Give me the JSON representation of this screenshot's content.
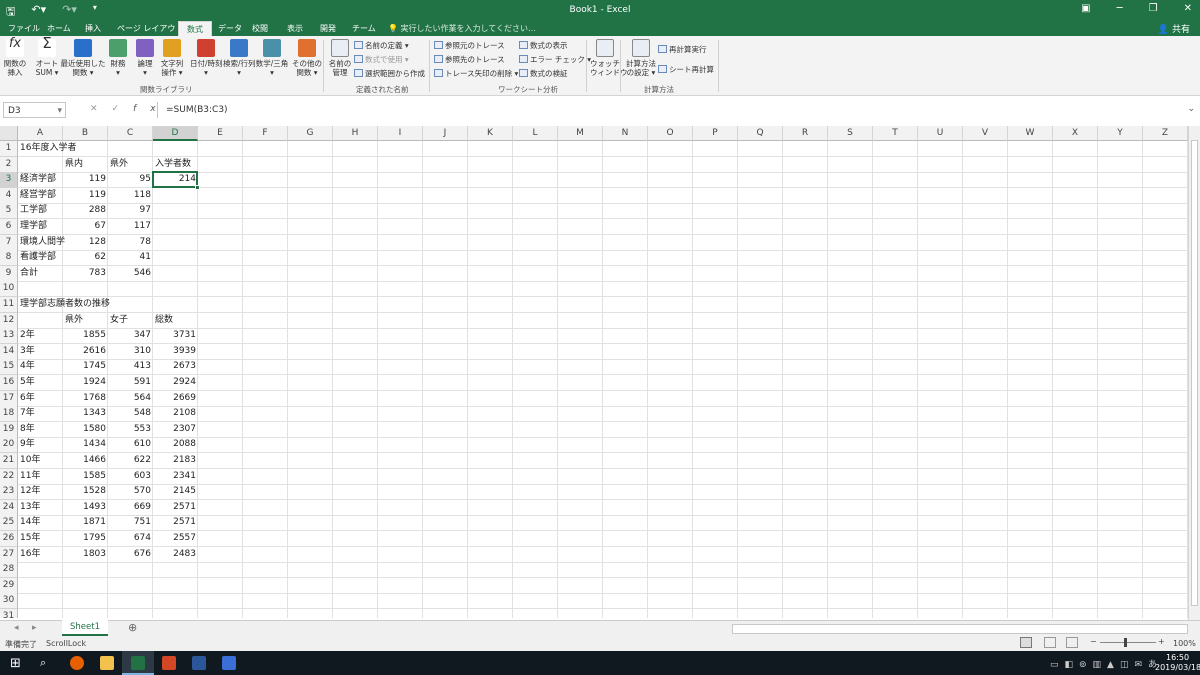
{
  "app": {
    "title": "Book1 - Excel",
    "share": "共有",
    "tellme": "実行したい作業を入力してください..."
  },
  "tabs": [
    "ファイル",
    "ホーム",
    "挿入",
    "ページ レイアウト",
    "数式",
    "データ",
    "校閲",
    "表示",
    "開発",
    "チーム"
  ],
  "ribbon": {
    "big_buttons": [
      {
        "label": "関数の\n挿入",
        "icon": "fx-icon"
      },
      {
        "label": "オート\nSUM ▾",
        "icon": "sigma-icon"
      },
      {
        "label": "最近使用した\n関数 ▾",
        "icon": "star-icon"
      },
      {
        "label": "財務\n▾",
        "icon": "finance-icon"
      },
      {
        "label": "論理\n▾",
        "icon": "question-icon"
      },
      {
        "label": "文字列\n操作 ▾",
        "icon": "text-icon"
      },
      {
        "label": "日付/時刻\n▾",
        "icon": "calendar-icon"
      },
      {
        "label": "検索/行列\n▾",
        "icon": "lookup-icon"
      },
      {
        "label": "数学/三角\n▾",
        "icon": "theta-icon"
      },
      {
        "label": "その他の\n関数 ▾",
        "icon": "more-icon"
      },
      {
        "label": "名前の\n管理",
        "icon": "name-manager-icon"
      },
      {
        "label": "ウォッチ\nウィンドウ",
        "icon": "watch-window-icon"
      },
      {
        "label": "計算方法\nの設定 ▾",
        "icon": "calc-options-icon"
      }
    ],
    "small_buttons": [
      {
        "label": "名前の定義 ▾",
        "dim": false
      },
      {
        "label": "数式で使用 ▾",
        "dim": true
      },
      {
        "label": "選択範囲から作成",
        "dim": false
      },
      {
        "label": "参照元のトレース",
        "dim": false
      },
      {
        "label": "参照先のトレース",
        "dim": false
      },
      {
        "label": "トレース矢印の削除 ▾",
        "dim": false
      },
      {
        "label": "数式の表示",
        "dim": false
      },
      {
        "label": "エラー チェック ▾",
        "dim": false
      },
      {
        "label": "数式の検証",
        "dim": false
      },
      {
        "label": "再計算実行",
        "dim": false
      },
      {
        "label": "シート再計算",
        "dim": false
      }
    ],
    "groups": [
      "関数ライブラリ",
      "定義された名前",
      "ワークシート分析",
      "計算方法"
    ]
  },
  "formula_bar": {
    "name_box": "D3",
    "formula": "=SUM(B3:C3)",
    "fx": "fx"
  },
  "columns": [
    "A",
    "B",
    "C",
    "D",
    "E",
    "F",
    "G",
    "H",
    "I",
    "J",
    "K",
    "L",
    "M",
    "N",
    "O",
    "P",
    "Q",
    "R",
    "S",
    "T",
    "U",
    "V",
    "W",
    "X",
    "Y",
    "Z"
  ],
  "rows": [
    "1",
    "2",
    "3",
    "4",
    "5",
    "6",
    "7",
    "8",
    "9",
    "10",
    "11",
    "12",
    "13",
    "14",
    "15",
    "16",
    "17",
    "18",
    "19",
    "20",
    "21",
    "22",
    "23",
    "24",
    "25",
    "26",
    "27",
    "28",
    "29",
    "30",
    "31"
  ],
  "sheet": [
    [
      "16年度入学者",
      "",
      "",
      ""
    ],
    [
      "",
      "県内",
      "県外",
      "入学者数"
    ],
    [
      "経済学部",
      "119",
      "95",
      "214"
    ],
    [
      "経営学部",
      "119",
      "118",
      ""
    ],
    [
      "工学部",
      "288",
      "97",
      ""
    ],
    [
      "理学部",
      "67",
      "117",
      ""
    ],
    [
      "環境人間学",
      "128",
      "78",
      ""
    ],
    [
      "看護学部",
      "62",
      "41",
      ""
    ],
    [
      "合計",
      "783",
      "546",
      ""
    ],
    [
      "",
      "",
      "",
      ""
    ],
    [
      "理学部志願者数の推移",
      "",
      "",
      ""
    ],
    [
      "",
      "県外",
      "女子",
      "総数"
    ],
    [
      "2年",
      "1855",
      "347",
      "3731"
    ],
    [
      "3年",
      "2616",
      "310",
      "3939"
    ],
    [
      "4年",
      "1745",
      "413",
      "2673"
    ],
    [
      "5年",
      "1924",
      "591",
      "2924"
    ],
    [
      "6年",
      "1768",
      "564",
      "2669"
    ],
    [
      "7年",
      "1343",
      "548",
      "2108"
    ],
    [
      "8年",
      "1580",
      "553",
      "2307"
    ],
    [
      "9年",
      "1434",
      "610",
      "2088"
    ],
    [
      "10年",
      "1466",
      "622",
      "2183"
    ],
    [
      "11年",
      "1585",
      "603",
      "2341"
    ],
    [
      "12年",
      "1528",
      "570",
      "2145"
    ],
    [
      "13年",
      "1493",
      "669",
      "2571"
    ],
    [
      "14年",
      "1871",
      "751",
      "2571"
    ],
    [
      "15年",
      "1795",
      "674",
      "2557"
    ],
    [
      "16年",
      "1803",
      "676",
      "2483"
    ]
  ],
  "sheet_tab": "Sheet1",
  "status": {
    "ready": "準備完了",
    "scrolllock": "ScrollLock",
    "zoom": "100%"
  },
  "clock": {
    "time": "16:50",
    "date": "2019/03/18"
  }
}
